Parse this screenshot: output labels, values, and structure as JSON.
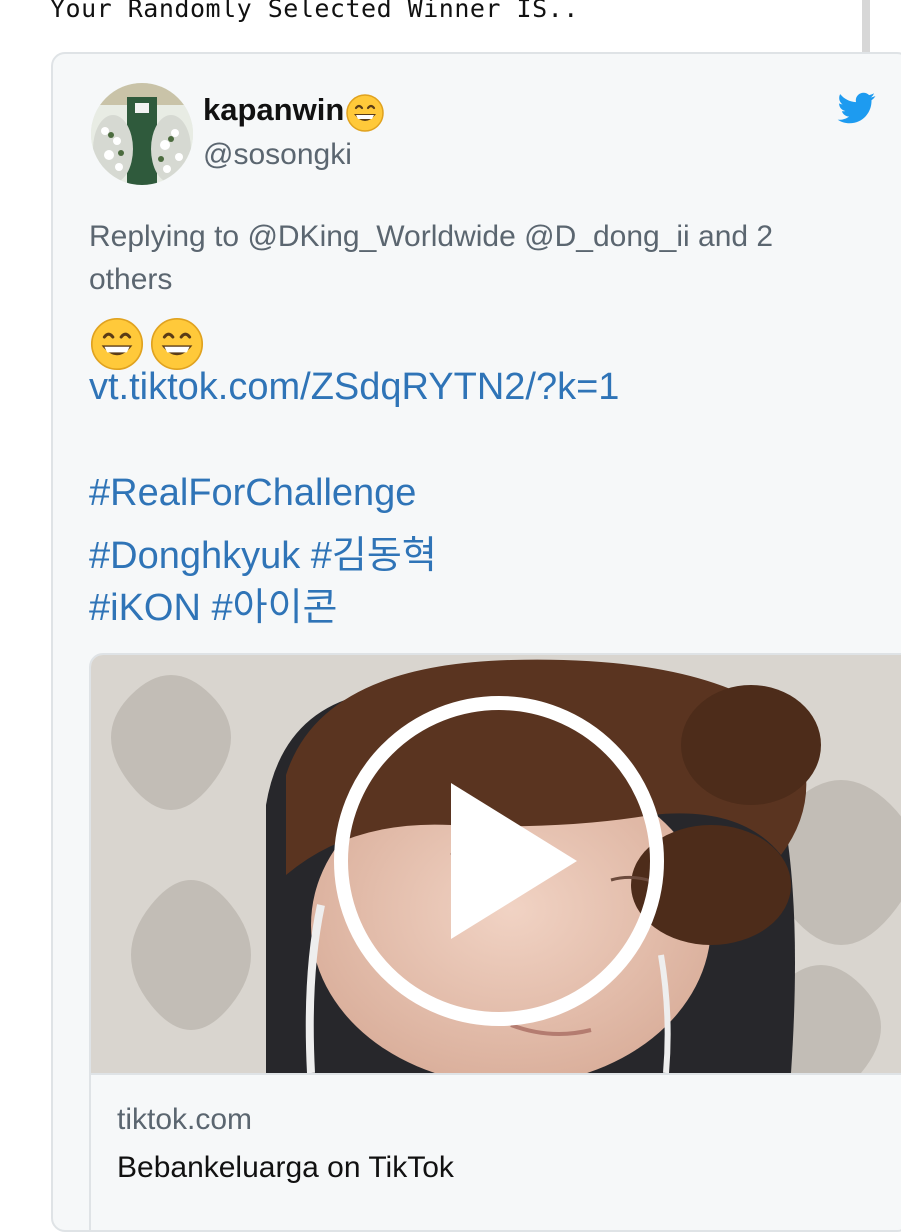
{
  "heading": "Your Randomly Selected Winner IS..",
  "tweet": {
    "display_name": "kapanwin",
    "name_emoji": "grinning-face-emoji",
    "handle": "@sosongki",
    "reply_prefix": "Replying to ",
    "reply_mentions": [
      "@DKing_Worldwide",
      "@D_dong_ii"
    ],
    "reply_others": "and 2 others",
    "emojis": [
      "grinning-face-emoji",
      "grinning-face-emoji"
    ],
    "link": "vt.tiktok.com/ZSdqRYTN2/?k=1",
    "hashtag_lines": [
      "#RealForChallenge",
      "#Donghkyuk #김동혁",
      "#iKON #아이콘"
    ]
  },
  "media": {
    "domain": "tiktok.com",
    "title": "Bebankeluarga on TikTok",
    "play_icon": "play-circle-icon"
  },
  "brand_icon": "twitter-bird-icon",
  "colors": {
    "link": "#2f74b7",
    "muted": "#5b6670",
    "card_bg": "#f6f8f9",
    "twitter_blue": "#1d9bf0",
    "emoji_yellow": "#ffc93a"
  }
}
